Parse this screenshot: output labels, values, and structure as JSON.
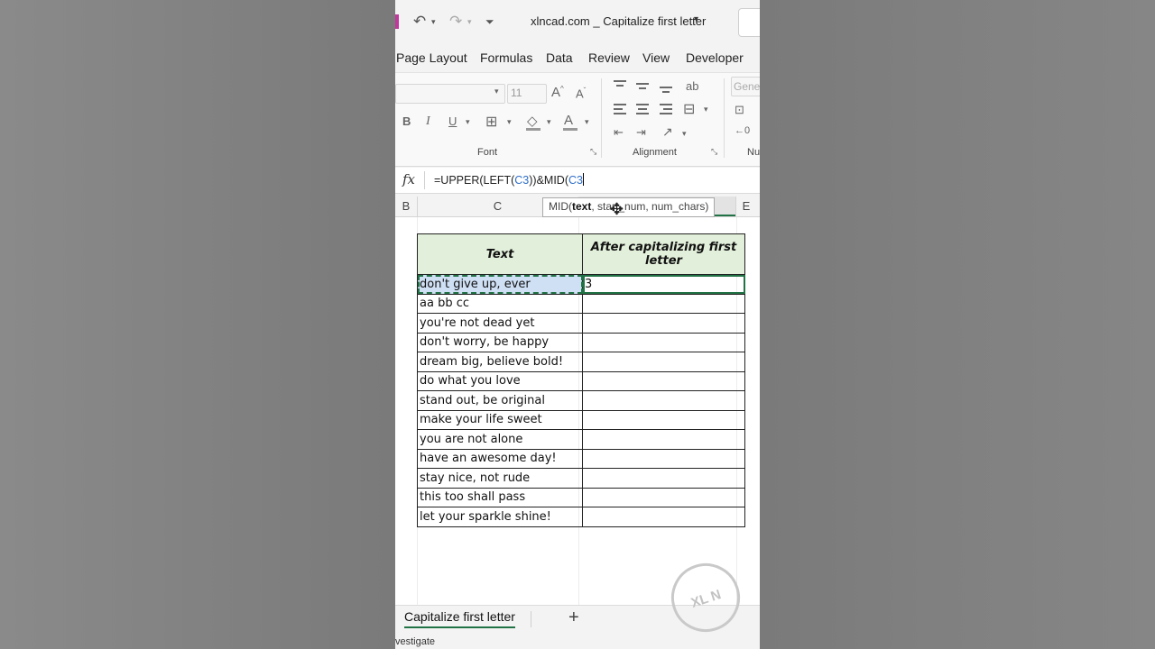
{
  "window": {
    "title": "xlncad.com _ Capitalize first letter",
    "title_caret": "▾"
  },
  "menu": {
    "tabs": [
      "Page Layout",
      "Formulas",
      "Data",
      "Review",
      "View",
      "Developer"
    ]
  },
  "ribbon": {
    "font_name": "",
    "font_size": "11",
    "number_format": "Gener",
    "groups": [
      "Font",
      "Alignment",
      "Nu"
    ],
    "buttons": {
      "bold": "B",
      "italic": "I",
      "underline": "U"
    }
  },
  "formula_bar": {
    "fx": "fx",
    "part1": "=UPPER(LEFT(",
    "ref1": "C3",
    "part2": "))&MID(",
    "ref2": "C3"
  },
  "tooltip": {
    "prefix": "MID(",
    "bold_arg": "text",
    "rest": ", start_num, num_chars)"
  },
  "columns": [
    "B",
    "C",
    "E"
  ],
  "table": {
    "headers": [
      "Text",
      "After capitalizing first letter"
    ],
    "rows": [
      [
        "don't give up, ever",
        "3"
      ],
      [
        "aa bb cc",
        ""
      ],
      [
        "you're not dead yet",
        ""
      ],
      [
        "don't worry, be happy",
        ""
      ],
      [
        "dream big, believe bold!",
        ""
      ],
      [
        "do what you love",
        ""
      ],
      [
        "stand out, be original",
        ""
      ],
      [
        "make your life sweet",
        ""
      ],
      [
        "you are not alone",
        ""
      ],
      [
        "have an awesome day!",
        ""
      ],
      [
        "stay nice, not rude",
        ""
      ],
      [
        "this too shall pass",
        ""
      ],
      [
        "let your sparkle shine!",
        ""
      ]
    ]
  },
  "sheet_tabs": {
    "active": "Capitalize first letter",
    "add": "+"
  },
  "status": {
    "text": "vestigate"
  },
  "watermark": "XL N CAD",
  "colors": {
    "accent": "#217346",
    "header_fill": "#e2efda",
    "ref_blue": "#2f6fc9"
  }
}
